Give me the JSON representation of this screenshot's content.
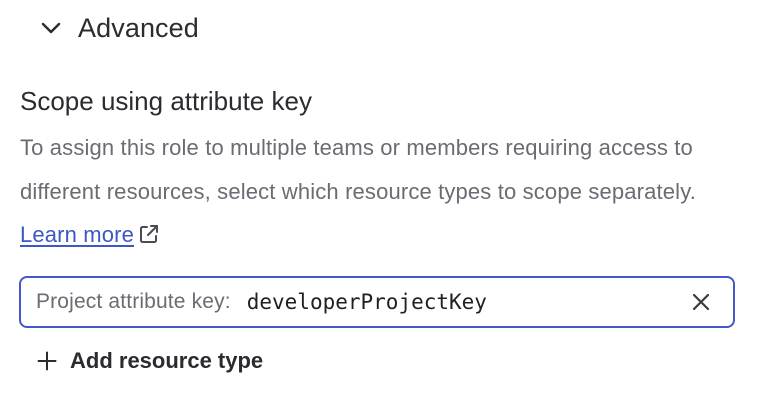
{
  "advanced": {
    "label": "Advanced",
    "icon": "chevron-down-icon"
  },
  "scope": {
    "title": "Scope using attribute key",
    "description": "To assign this role to multiple teams or members requiring access to different resources, select which resource types to scope separately.",
    "learn_more": "Learn more",
    "learn_more_icon": "external-link-icon",
    "attribute_field": {
      "prefix": "Project attribute key:",
      "value": "developerProjectKey",
      "clear_icon": "close-icon",
      "border_color": "#4658c9"
    },
    "add_resource_label": "Add resource type",
    "add_resource_icon": "plus-icon"
  },
  "colors": {
    "link": "#3d57c7",
    "text": "#2b2b30",
    "muted": "#6b6b73"
  }
}
